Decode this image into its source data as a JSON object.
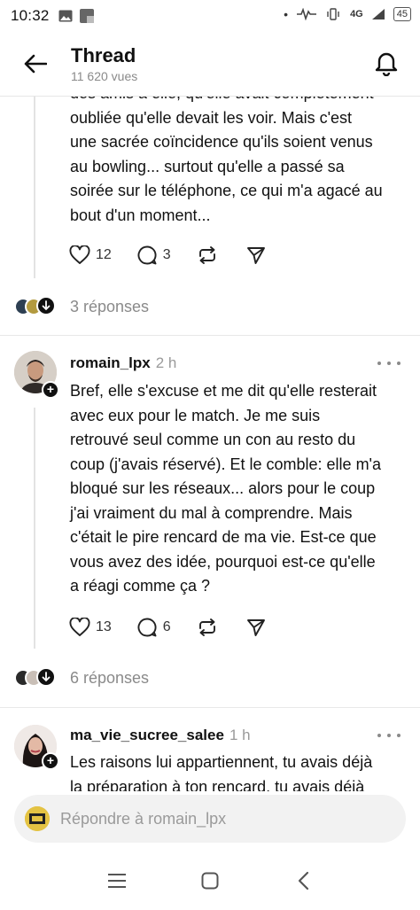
{
  "status": {
    "time": "10:32",
    "network": "4G",
    "battery": "45"
  },
  "header": {
    "title": "Thread",
    "views": "11 620 vues"
  },
  "post1": {
    "partial_line": "des amis à elle, qu'elle avait complètement",
    "lines": [
      "oubliée qu'elle devait les voir. Mais c'est",
      "une sacrée coïncidence qu'ils soient venus",
      "au bowling... surtout qu'elle a passé sa",
      "soirée sur le téléphone, ce qui m'a agacé au",
      "bout d'un moment..."
    ],
    "likes": "12",
    "comments": "3",
    "replies_label": "3 réponses"
  },
  "post2": {
    "username": "romain_lpx",
    "time": "2 h",
    "lines": [
      "Bref, elle s'excuse et me dit qu'elle resterait",
      "avec eux pour le match. Je me suis",
      "retrouvé seul comme un con au resto du",
      "coup (j'avais réservé). Et le comble: elle m'a",
      "bloqué sur les réseaux... alors pour le coup",
      "j'ai vraiment du mal à comprendre. Mais",
      "c'était le pire rencard de ma vie. Est-ce que",
      "vous avez des idée, pourquoi est-ce qu'elle",
      "a réagi comme ça ?"
    ],
    "likes": "13",
    "comments": "6",
    "replies_label": "6 réponses"
  },
  "post3": {
    "username": "ma_vie_sucree_salee",
    "time": "1 h",
    "first_line": "Les raisons lui appartiennent, tu avais déjà",
    "cut_line": "la préparation à ton rencard, tu avais déjà"
  },
  "reply_bar": {
    "placeholder": "Répondre à romain_lpx"
  },
  "icons": {
    "back": "arrow-left-icon",
    "bell": "bell-icon",
    "like": "heart-icon",
    "comment": "comment-icon",
    "repost": "repost-icon",
    "share": "send-icon",
    "nav_recents": "menu-lines-icon",
    "nav_home": "square-icon",
    "nav_back": "chevron-left-icon"
  }
}
